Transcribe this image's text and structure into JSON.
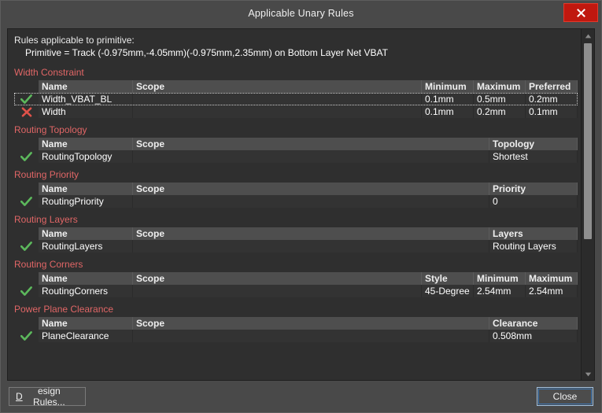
{
  "window": {
    "title": "Applicable Unary Rules",
    "close_icon": "close-x-icon"
  },
  "header": {
    "line1": "Rules applicable to primitive:",
    "line2": "Primitive = Track (-0.975mm,-4.05mm)(-0.975mm,2.35mm) on Bottom Layer Net VBAT"
  },
  "colors": {
    "section_title": "#e06666",
    "check_green": "#5cb85c",
    "cross_red": "#e0524a",
    "close_button": "#c0180f",
    "header_row": "#4e4e4e",
    "data_row": "#333333",
    "panel": "#2f2f2f"
  },
  "sections": [
    {
      "title": "Width Constraint",
      "columns": [
        "Name",
        "Scope",
        "Minimum",
        "Maximum",
        "Preferred"
      ],
      "rows": [
        {
          "status": "check",
          "selected": true,
          "cells": [
            "Width_VBAT_BL",
            "",
            "0.1mm",
            "0.5mm",
            "0.2mm"
          ]
        },
        {
          "status": "cross",
          "selected": false,
          "cells": [
            "Width",
            "",
            "0.1mm",
            "0.2mm",
            "0.1mm"
          ]
        }
      ]
    },
    {
      "title": "Routing Topology",
      "columns": [
        "Name",
        "Scope",
        "Topology"
      ],
      "rows": [
        {
          "status": "check",
          "selected": false,
          "cells": [
            "RoutingTopology",
            "",
            "Shortest"
          ]
        }
      ]
    },
    {
      "title": "Routing Priority",
      "columns": [
        "Name",
        "Scope",
        "Priority"
      ],
      "rows": [
        {
          "status": "check",
          "selected": false,
          "cells": [
            "RoutingPriority",
            "",
            "0"
          ]
        }
      ]
    },
    {
      "title": "Routing Layers",
      "columns": [
        "Name",
        "Scope",
        "Layers"
      ],
      "rows": [
        {
          "status": "check",
          "selected": false,
          "cells": [
            "RoutingLayers",
            "",
            "Routing Layers"
          ]
        }
      ]
    },
    {
      "title": "Routing Corners",
      "columns": [
        "Name",
        "Scope",
        "Style",
        "Minimum",
        "Maximum"
      ],
      "rows": [
        {
          "status": "check",
          "selected": false,
          "cells": [
            "RoutingCorners",
            "",
            "45-Degree",
            "2.54mm",
            "2.54mm"
          ]
        }
      ]
    },
    {
      "title": "Power Plane Clearance",
      "columns": [
        "Name",
        "Scope",
        "Clearance"
      ],
      "rows": [
        {
          "status": "check",
          "selected": false,
          "cells": [
            "PlaneClearance",
            "",
            "0.508mm"
          ]
        }
      ]
    }
  ],
  "scrollbar": {
    "up_icon": "scroll-up-arrow-icon",
    "down_icon": "scroll-down-arrow-icon"
  },
  "footer": {
    "design_rules_label": "Design Rules...",
    "design_rules_accel": "D",
    "close_label": "Close"
  }
}
